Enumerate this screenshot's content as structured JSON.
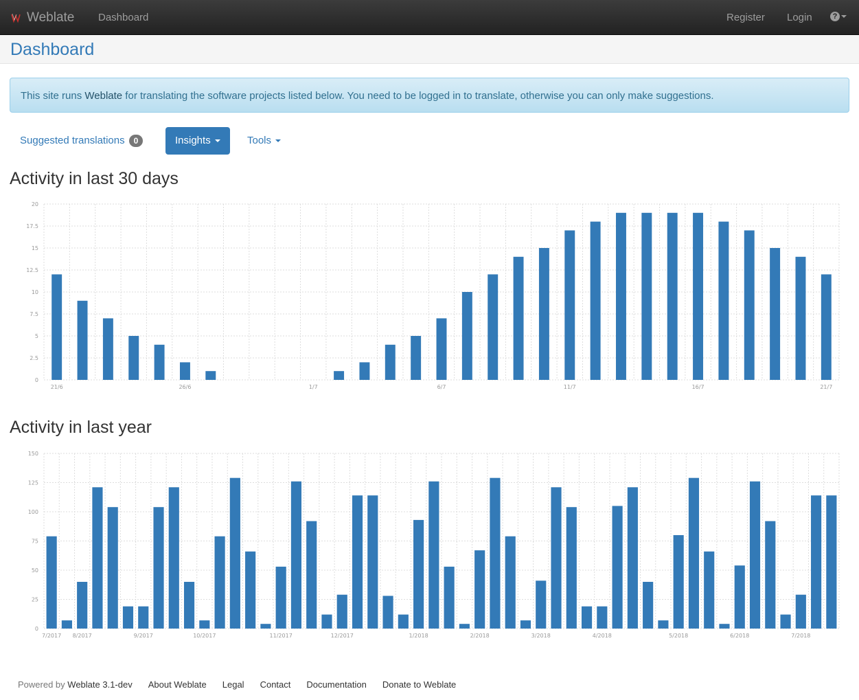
{
  "navbar": {
    "brand": "Weblate",
    "dashboard": "Dashboard",
    "register": "Register",
    "login": "Login",
    "help_icon": "question-circle-icon"
  },
  "header": {
    "title": "Dashboard"
  },
  "alert": {
    "prefix": "This site runs ",
    "link": "Weblate",
    "suffix": " for translating the software projects listed below. You need to be logged in to translate, otherwise you can only make suggestions."
  },
  "tabs": {
    "suggested_label": "Suggested translations",
    "suggested_count": "0",
    "insights_label": "Insights",
    "tools_label": "Tools"
  },
  "sections": {
    "month_title": "Activity in last 30 days",
    "year_title": "Activity in last year"
  },
  "colors": {
    "bar": "#337ab7",
    "grid": "#dddddd",
    "link": "#337ab7"
  },
  "chart_data": [
    {
      "type": "bar",
      "title": "Activity in last 30 days",
      "categories": [
        "21/6",
        "22/6",
        "23/6",
        "24/6",
        "25/6",
        "26/6",
        "27/6",
        "28/6",
        "29/6",
        "30/6",
        "1/7",
        "2/7",
        "3/7",
        "4/7",
        "5/7",
        "6/7",
        "7/7",
        "8/7",
        "9/7",
        "10/7",
        "11/7",
        "12/7",
        "13/7",
        "14/7",
        "15/7",
        "16/7",
        "17/7",
        "18/7",
        "19/7",
        "20/7",
        "21/7"
      ],
      "values": [
        12,
        9,
        7,
        5,
        4,
        2,
        1,
        0,
        0,
        0,
        0,
        1,
        2,
        4,
        5,
        7,
        10,
        12,
        14,
        15,
        17,
        18,
        19,
        19,
        19,
        19,
        18,
        17,
        15,
        14,
        12
      ],
      "x_tick_labels": [
        "21/6",
        "26/6",
        "1/7",
        "6/7",
        "11/7",
        "16/7",
        "21/7"
      ],
      "x_tick_indices": [
        0,
        5,
        10,
        15,
        20,
        25,
        30
      ],
      "y_ticks": [
        "0",
        "2.5",
        "5",
        "7.5",
        "10",
        "12.5",
        "15",
        "17.5",
        "20"
      ],
      "ylim": [
        0,
        20
      ],
      "grid": true
    },
    {
      "type": "bar",
      "title": "Activity in last year",
      "values": [
        79,
        7,
        40,
        121,
        104,
        19,
        19,
        104,
        121,
        40,
        7,
        79,
        129,
        66,
        4,
        53,
        126,
        92,
        12,
        29,
        114,
        114,
        28,
        12,
        93,
        126,
        53,
        4,
        67,
        129,
        79,
        7,
        41,
        121,
        104,
        19,
        19,
        105,
        121,
        40,
        7,
        80,
        129,
        66,
        4,
        54,
        126,
        92,
        12,
        29,
        114,
        114
      ],
      "x_tick_labels": [
        "7/2017",
        "8/2017",
        "9/2017",
        "10/2017",
        "11/2017",
        "12/2017",
        "1/2018",
        "2/2018",
        "3/2018",
        "4/2018",
        "5/2018",
        "6/2018",
        "7/2018"
      ],
      "x_tick_indices": [
        0,
        2,
        6,
        10,
        15,
        19,
        24,
        28,
        32,
        36,
        41,
        45,
        49
      ],
      "y_ticks": [
        "0",
        "25",
        "50",
        "75",
        "100",
        "125",
        "150"
      ],
      "ylim": [
        0,
        150
      ],
      "grid": true
    }
  ],
  "footer": {
    "powered_by": "Powered by",
    "weblate_version": "Weblate 3.1-dev",
    "links": [
      "About Weblate",
      "Legal",
      "Contact",
      "Documentation",
      "Donate to Weblate"
    ]
  }
}
